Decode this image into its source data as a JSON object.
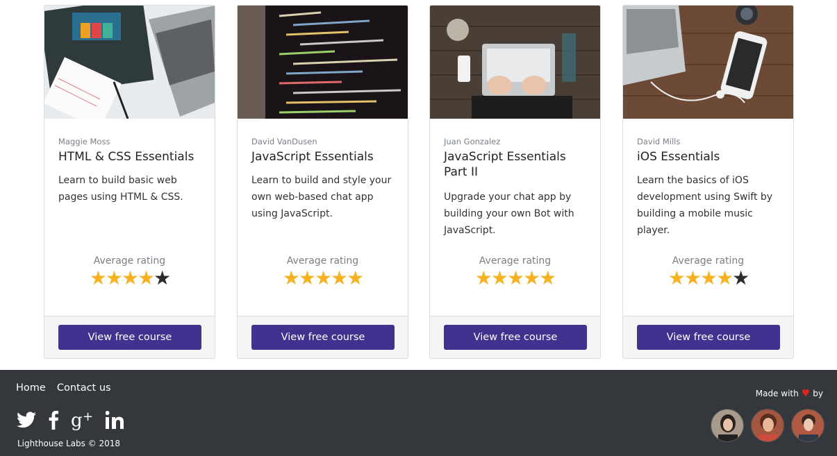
{
  "courses": [
    {
      "author": "Maggie Moss",
      "title": "HTML & CSS Essentials",
      "description": "Learn to build basic web pages using HTML & CSS.",
      "rating_label": "Average rating",
      "rating": 4,
      "rating_max": 5,
      "button": "View free course",
      "image": "laptop-with-html-css-book"
    },
    {
      "author": "David VanDusen",
      "title": "JavaScript Essentials",
      "description": "Learn to build and style your own web-based chat app using JavaScript.",
      "rating_label": "Average rating",
      "rating": 5,
      "rating_max": 5,
      "button": "View free course",
      "image": "code-on-screen"
    },
    {
      "author": "Juan Gonzalez",
      "title": "JavaScript Essentials Part II",
      "description": "Upgrade your chat app by building your own Bot with JavaScript.",
      "rating_label": "Average rating",
      "rating": 5,
      "rating_max": 5,
      "button": "View free course",
      "image": "hands-typing-on-laptop"
    },
    {
      "author": "David Mills",
      "title": "iOS Essentials",
      "description": "Learn the basics of iOS development using Swift by building a mobile music player.",
      "rating_label": "Average rating",
      "rating": 4,
      "rating_max": 5,
      "button": "View free course",
      "image": "laptop-and-phone-on-wood"
    }
  ],
  "footer": {
    "nav": [
      "Home",
      "Contact us"
    ],
    "social": [
      "twitter-icon",
      "facebook-icon",
      "google-plus-icon",
      "linkedin-icon"
    ],
    "copyright": "Lighthouse Labs © 2018",
    "made_with_prefix": "Made with",
    "made_with_suffix": "by",
    "heart_color": "#e02424",
    "avatars": [
      "avatar-1",
      "avatar-2",
      "avatar-3"
    ]
  },
  "colors": {
    "button": "#42318e",
    "star_on": "#f5b324",
    "star_off": "#2b2b2b",
    "footer_bg": "#34373c"
  }
}
